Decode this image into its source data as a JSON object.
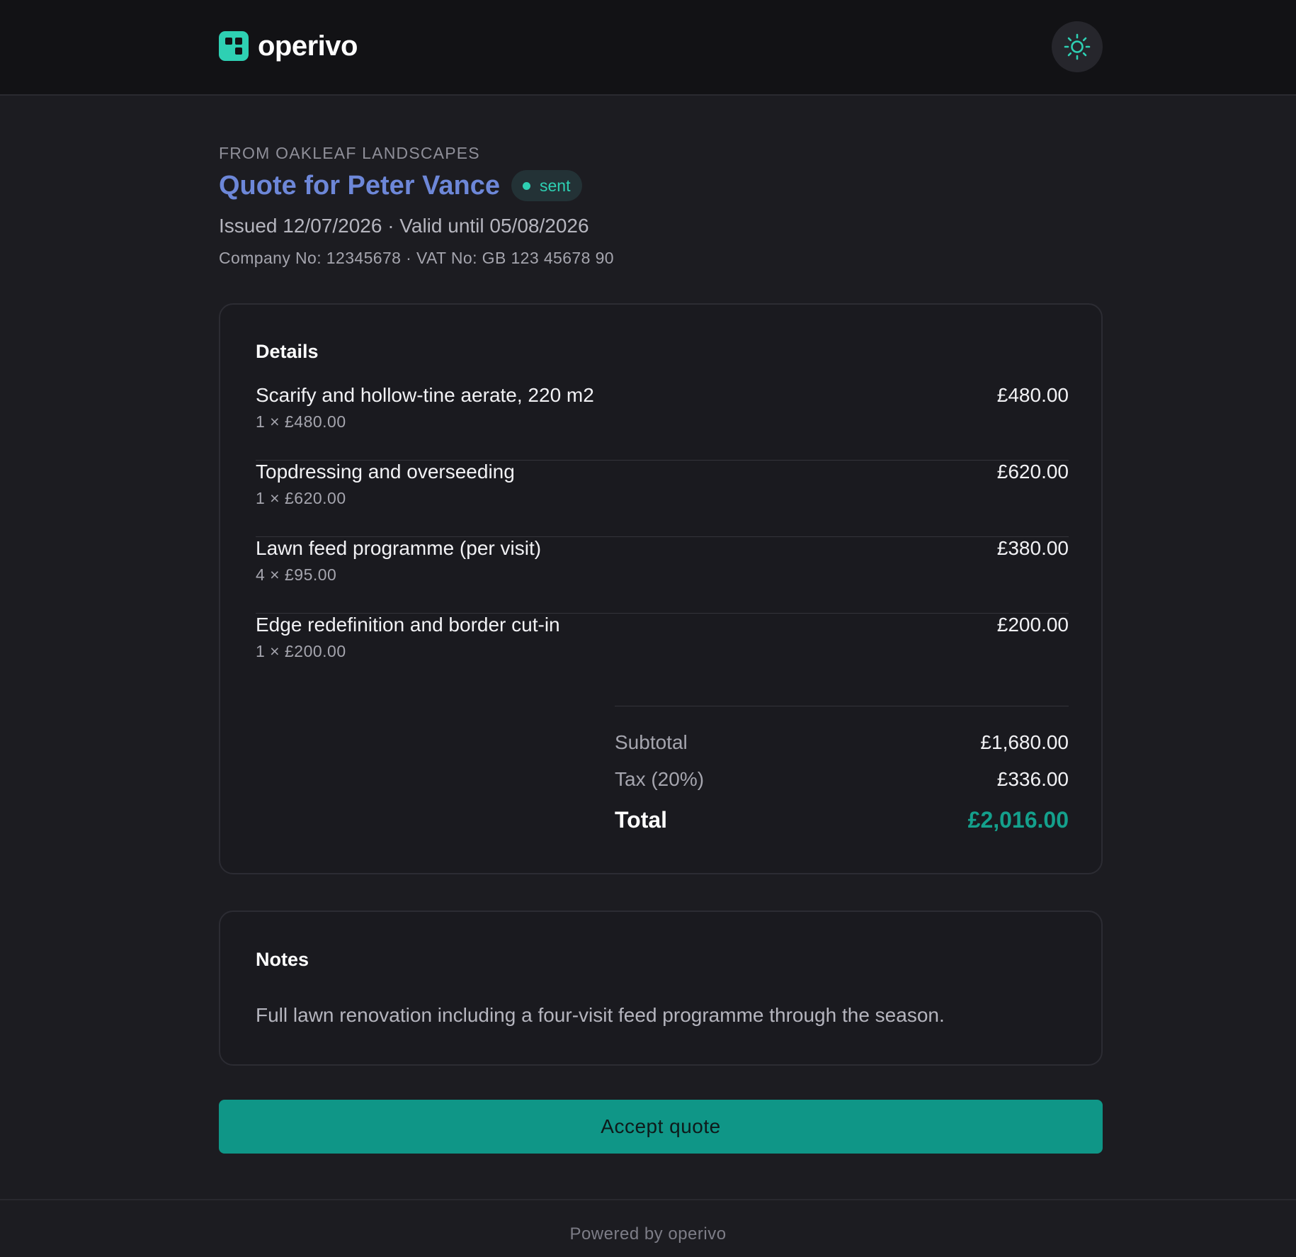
{
  "brand": {
    "name": "operivo",
    "accent": "#2ed0b3"
  },
  "header": {
    "theme_toggle_icon": "sun-icon"
  },
  "quote": {
    "from": "FROM OAKLEAF LANDSCAPES",
    "title": "Quote for Peter Vance",
    "status": "sent",
    "dates": "Issued 12/07/2026 · Valid until 05/08/2026",
    "company": "Company No: 12345678 · VAT No: GB 123 45678 90"
  },
  "details": {
    "heading": "Details",
    "items": [
      {
        "description": "Scarify and hollow-tine aerate, 220 m2",
        "qty": "1 × £480.00",
        "amount": "£480.00"
      },
      {
        "description": "Topdressing and overseeding",
        "qty": "1 × £620.00",
        "amount": "£620.00"
      },
      {
        "description": "Lawn feed programme (per visit)",
        "qty": "4 × £95.00",
        "amount": "£380.00"
      },
      {
        "description": "Edge redefinition and border cut-in",
        "qty": "1 × £200.00",
        "amount": "£200.00"
      }
    ],
    "subtotal_label": "Subtotal",
    "subtotal": "£1,680.00",
    "tax_label": "Tax (20%)",
    "tax": "£336.00",
    "total_label": "Total",
    "total": "£2,016.00"
  },
  "notes": {
    "heading": "Notes",
    "text": "Full lawn renovation including a four-visit feed programme through the season."
  },
  "actions": {
    "accept_label": "Accept quote"
  },
  "footer": {
    "text": "Powered by operivo"
  }
}
